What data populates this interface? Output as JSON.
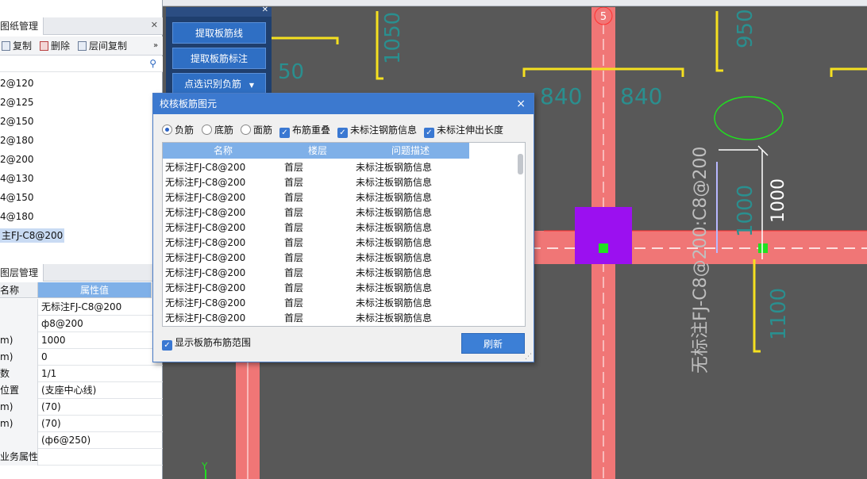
{
  "left_panel": {
    "drawing_tab": "图纸管理",
    "toolbar": {
      "copy": "复制",
      "delete": "删除",
      "copy_between_floors": "层间复制"
    },
    "items": [
      "2@120",
      "2@125",
      "2@150",
      "2@180",
      "2@200",
      "4@130",
      "4@150",
      "4@180",
      "主FJ-C8@200"
    ],
    "selected_index": 8,
    "layer_tab": "图层管理",
    "prop_header": {
      "name": "名称",
      "value": "属性值"
    },
    "props": [
      {
        "k": "",
        "v": "无标注FJ-C8@200"
      },
      {
        "k": "",
        "v": "ф8@200"
      },
      {
        "k": "m)",
        "v": "1000"
      },
      {
        "k": "m)",
        "v": "0"
      },
      {
        "k": "数",
        "v": "1/1"
      },
      {
        "k": "位置",
        "v": "(支座中心线)"
      },
      {
        "k": "m)",
        "v": "(70)"
      },
      {
        "k": "m)",
        "v": "(70)"
      },
      {
        "k": "",
        "v": "(ф6@250)"
      },
      {
        "k": "业务属性",
        "v": ""
      }
    ]
  },
  "cmd_panel": {
    "buttons": [
      "提取板筋线",
      "提取板筋标注",
      "点选识别负筋"
    ],
    "dropdown_arrow": "▼"
  },
  "canvas": {
    "axis_label": "5",
    "dims": [
      "1050",
      "950",
      "840",
      "840",
      "50",
      "1000",
      "1000",
      "1100"
    ],
    "rebar_label": "无标注FJ-C8@200:C8@200",
    "y_axis": "Y"
  },
  "dialog": {
    "title": "校核板筋图元",
    "close": "×",
    "options": {
      "neg_bar": "负筋",
      "bottom_bar": "底筋",
      "top_bar": "面筋",
      "overlap": "布筋重叠",
      "unlabeled_info": "未标注钢筋信息",
      "unlabeled_extend": "未标注伸出长度"
    },
    "columns": [
      "名称",
      "楼层",
      "问题描述"
    ],
    "rows": [
      [
        "无标注FJ-C8@200",
        "首层",
        "未标注板钢筋信息"
      ],
      [
        "无标注FJ-C8@200",
        "首层",
        "未标注板钢筋信息"
      ],
      [
        "无标注FJ-C8@200",
        "首层",
        "未标注板钢筋信息"
      ],
      [
        "无标注FJ-C8@200",
        "首层",
        "未标注板钢筋信息"
      ],
      [
        "无标注FJ-C8@200",
        "首层",
        "未标注板钢筋信息"
      ],
      [
        "无标注FJ-C8@200",
        "首层",
        "未标注板钢筋信息"
      ],
      [
        "无标注FJ-C8@200",
        "首层",
        "未标注板钢筋信息"
      ],
      [
        "无标注FJ-C8@200",
        "首层",
        "未标注板钢筋信息"
      ],
      [
        "无标注FJ-C8@200",
        "首层",
        "未标注板钢筋信息"
      ],
      [
        "无标注FJ-C8@200",
        "首层",
        "未标注板钢筋信息"
      ],
      [
        "无标注FJ-C8@200",
        "首层",
        "未标注板钢筋信息"
      ]
    ],
    "show_range": "显示板筋布筋范围",
    "refresh": "刷新"
  }
}
